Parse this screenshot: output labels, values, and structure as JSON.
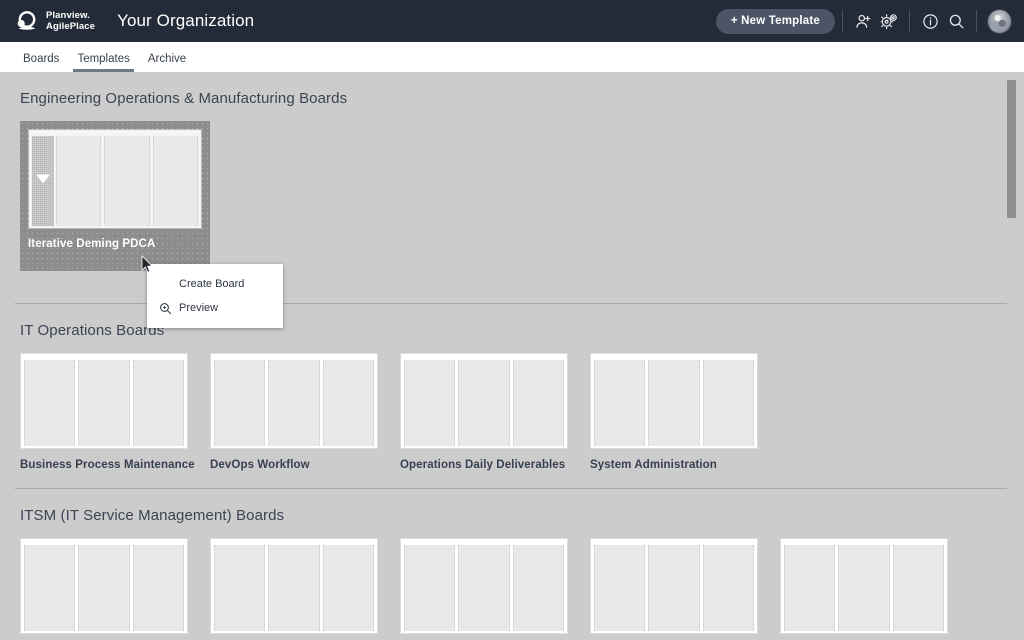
{
  "header": {
    "brand": {
      "line1": "Planview.",
      "line2": "AgilePlace",
      "icon": "planview-logo-icon"
    },
    "org_title": "Your Organization",
    "new_template_label": "+ New Template",
    "icons": [
      {
        "name": "add-user-icon",
        "title": "Invite user"
      },
      {
        "name": "settings-gears-icon",
        "title": "Settings"
      },
      {
        "name": "info-icon",
        "title": "Information"
      },
      {
        "name": "search-icon",
        "title": "Search"
      }
    ],
    "avatar_label": "User avatar",
    "bg_color": "#242b38",
    "button_color": "#4c5565"
  },
  "tabs": [
    {
      "label": "Boards",
      "active": false
    },
    {
      "label": "Templates",
      "active": true
    },
    {
      "label": "Archive",
      "active": false
    }
  ],
  "sections": [
    {
      "title": "Engineering Operations & Manufacturing Boards",
      "cards": [
        {
          "label": "Iterative Deming PDCA",
          "selected": true,
          "columns": 3
        }
      ]
    },
    {
      "title": "IT Operations Boards",
      "cards": [
        {
          "label": "Business Process Maintenance",
          "selected": false,
          "columns": 3
        },
        {
          "label": "DevOps Workflow",
          "selected": false,
          "columns": 3
        },
        {
          "label": "Operations Daily Deliverables",
          "selected": false,
          "columns": 3
        },
        {
          "label": "System Administration",
          "selected": false,
          "columns": 3
        }
      ]
    },
    {
      "title": "ITSM (IT Service Management) Boards",
      "cards": [
        {
          "label": "",
          "selected": false,
          "columns": 3
        },
        {
          "label": "",
          "selected": false,
          "columns": 3
        },
        {
          "label": "",
          "selected": false,
          "columns": 3
        },
        {
          "label": "",
          "selected": false,
          "columns": 3
        },
        {
          "label": "",
          "selected": false,
          "columns": 3
        }
      ]
    }
  ],
  "context_menu": {
    "items": [
      {
        "label": "Create Board",
        "icon": null
      },
      {
        "label": "Preview",
        "icon": "magnifier-icon"
      }
    ]
  },
  "colors": {
    "page_background": "#cccccc",
    "divider": "#a9a9a9",
    "card_label": "#37404e",
    "selected_overlay": "#8d8d8d",
    "scrollbar_thumb": "#8f8f8f",
    "tab_underline": "#6f7886"
  }
}
